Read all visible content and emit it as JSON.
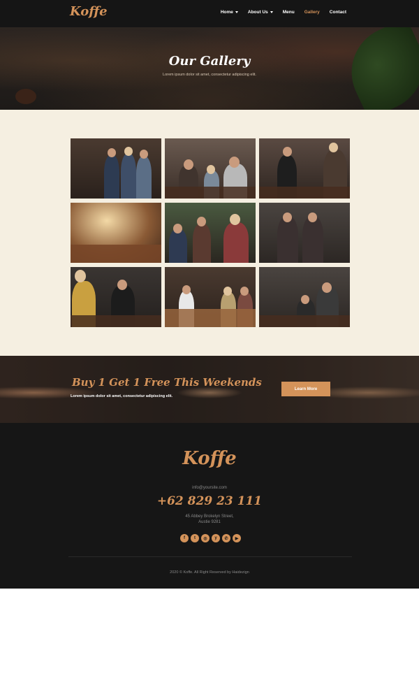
{
  "header": {
    "logo": "Koffe",
    "nav": [
      {
        "label": "Home",
        "dropdown": true,
        "active": false
      },
      {
        "label": "About Us",
        "dropdown": true,
        "active": false
      },
      {
        "label": "Menu",
        "dropdown": false,
        "active": false
      },
      {
        "label": "Gallery",
        "dropdown": false,
        "active": true
      },
      {
        "label": "Contact",
        "dropdown": false,
        "active": false
      }
    ]
  },
  "hero": {
    "title": "Our Gallery",
    "subtitle": "Lorem ipsum dolor sit amet, consectetur adipiscing elit."
  },
  "gallery": {
    "photos": [
      {
        "icon": "baristas-team-photo"
      },
      {
        "icon": "friends-at-table-photo"
      },
      {
        "icon": "barista-at-register-photo"
      },
      {
        "icon": "cafe-interior-photo"
      },
      {
        "icon": "friends-coffee-photo"
      },
      {
        "icon": "baristas-counter-photo"
      },
      {
        "icon": "customer-ordering-photo"
      },
      {
        "icon": "pastry-counter-photo"
      },
      {
        "icon": "barista-espresso-photo"
      }
    ]
  },
  "promo": {
    "title": "Buy 1 Get 1 Free This Weekends",
    "subtitle": "Lorem ipsum dolor sit amet, consectetur adipiscing elit.",
    "button": "Learn More"
  },
  "footer": {
    "logo": "Koffe",
    "email": "info@yoursite.com",
    "phone": "+62 829 23 111",
    "address_line1": "45 Abbey Brokelyn Street,",
    "address_line2": "Austie 9281",
    "social": [
      {
        "icon": "facebook-icon",
        "glyph": "f"
      },
      {
        "icon": "twitter-icon",
        "glyph": "t"
      },
      {
        "icon": "instagram-icon",
        "glyph": "◎"
      },
      {
        "icon": "yelp-icon",
        "glyph": "y"
      },
      {
        "icon": "whatsapp-icon",
        "glyph": "✆"
      },
      {
        "icon": "youtube-icon",
        "glyph": "▶"
      }
    ],
    "copyright": "2020 © Koffe. All Right Reserved by Haidezign"
  },
  "colors": {
    "accent": "#d4935a",
    "header_bg": "#151515",
    "gallery_bg": "#f5efe1",
    "footer_bg": "#161616"
  }
}
